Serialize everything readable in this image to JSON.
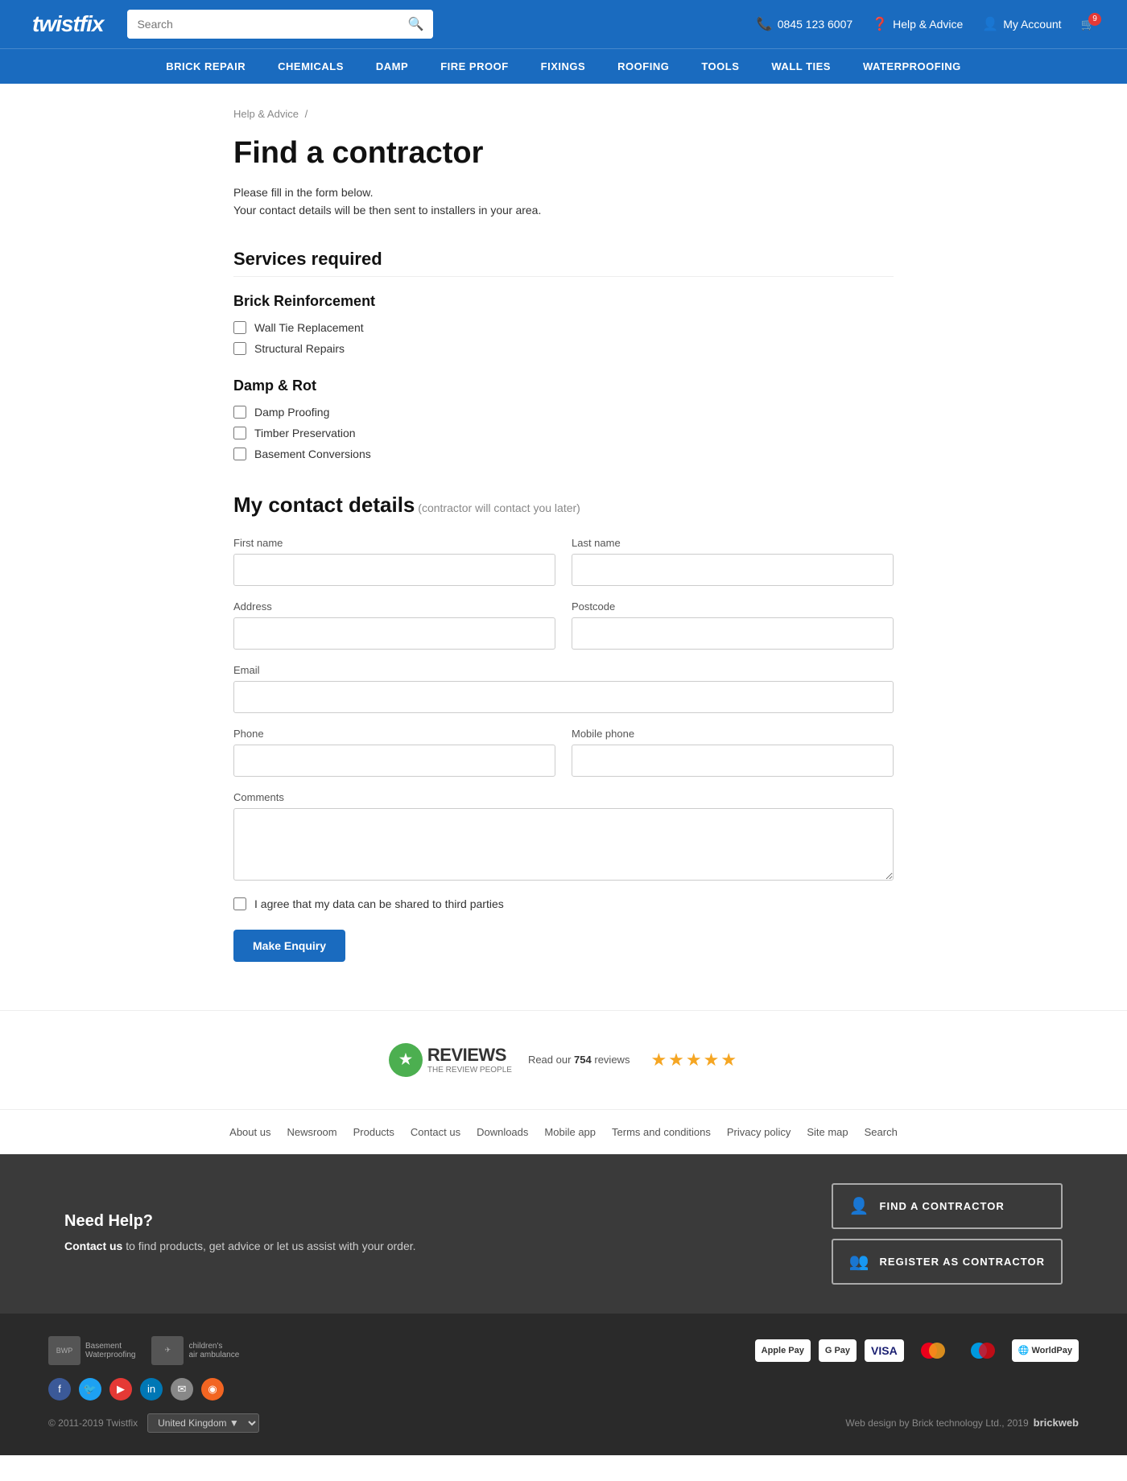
{
  "site": {
    "logo": "twistfix"
  },
  "header": {
    "search_placeholder": "Search",
    "phone": "0845 123 6007",
    "help_label": "Help & Advice",
    "account_label": "My Account",
    "cart_count": "9"
  },
  "nav": {
    "items": [
      {
        "id": "brick-repair",
        "label": "BRICK REPAIR"
      },
      {
        "id": "chemicals",
        "label": "CHEMICALS"
      },
      {
        "id": "damp",
        "label": "DAMP"
      },
      {
        "id": "fire-proof",
        "label": "FIRE PROOF"
      },
      {
        "id": "fixings",
        "label": "FIXINGS"
      },
      {
        "id": "roofing",
        "label": "ROOFING"
      },
      {
        "id": "tools",
        "label": "TOOLS"
      },
      {
        "id": "wall-ties",
        "label": "WALL TIES"
      },
      {
        "id": "waterproofing",
        "label": "WATERPROOFING"
      }
    ]
  },
  "breadcrumb": {
    "parent": "Help & Advice",
    "separator": "/"
  },
  "page": {
    "title": "Find a contractor",
    "desc_line1": "Please fill in the form below.",
    "desc_line2": "Your contact details will be then sent to installers in your area."
  },
  "services": {
    "title": "Services required",
    "brick_reinforcement": {
      "title": "Brick Reinforcement",
      "items": [
        {
          "id": "wall-tie",
          "label": "Wall Tie Replacement"
        },
        {
          "id": "structural",
          "label": "Structural Repairs"
        }
      ]
    },
    "damp_rot": {
      "title": "Damp & Rot",
      "items": [
        {
          "id": "damp-proofing",
          "label": "Damp Proofing"
        },
        {
          "id": "timber",
          "label": "Timber Preservation"
        },
        {
          "id": "basement",
          "label": "Basement Conversions"
        }
      ]
    }
  },
  "contact_form": {
    "title": "My contact details",
    "subtitle": "(contractor will contact you later)",
    "fields": {
      "first_name_label": "First name",
      "last_name_label": "Last name",
      "address_label": "Address",
      "postcode_label": "Postcode",
      "email_label": "Email",
      "phone_label": "Phone",
      "mobile_label": "Mobile phone",
      "comments_label": "Comments"
    },
    "agree_text": "I agree that my data can be shared to third parties",
    "submit_label": "Make enquiry"
  },
  "reviews": {
    "text": "Read our",
    "count": "754",
    "text2": "reviews",
    "stars": "★★★★★"
  },
  "footer_links": {
    "items": [
      {
        "label": "About us"
      },
      {
        "label": "Newsroom"
      },
      {
        "label": "Products"
      },
      {
        "label": "Contact us"
      },
      {
        "label": "Downloads"
      },
      {
        "label": "Mobile app"
      },
      {
        "label": "Terms and conditions"
      },
      {
        "label": "Privacy policy"
      },
      {
        "label": "Site map"
      },
      {
        "label": "Search"
      }
    ]
  },
  "cta": {
    "title": "Need Help?",
    "desc_link": "Contact us",
    "desc_rest": " to find products, get advice or let us assist with your order.",
    "find_contractor": "FIND A CONTRACTOR",
    "register_contractor": "REGISTER AS CONTRACTOR"
  },
  "bottom_footer": {
    "copyright": "© 2011-2019 Twistfix",
    "country": "United Kingdom",
    "web_design": "Web design by Brick technology Ltd., 2019",
    "brickweb": "brickweb",
    "payment_methods": [
      "Apple Pay",
      "G Pay",
      "VISA",
      "MC",
      "Maestro",
      "WorldPay"
    ]
  }
}
